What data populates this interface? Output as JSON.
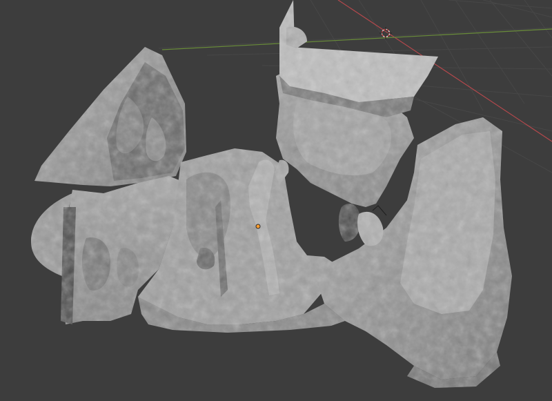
{
  "app": "3D viewport",
  "viewport": {
    "background_color": "#3d3d3d",
    "grid_color": "#4a4a4a",
    "x_axis_color": "#b3484c",
    "y_axis_color": "#6a8d3a",
    "mesh_color": "#9a9a9a",
    "mesh_shadow_color": "#5c5c5c",
    "origin_color": "#ff9d2e"
  },
  "icons": {
    "cursor": "3d-cursor-icon",
    "origin": "object-origin-icon"
  }
}
